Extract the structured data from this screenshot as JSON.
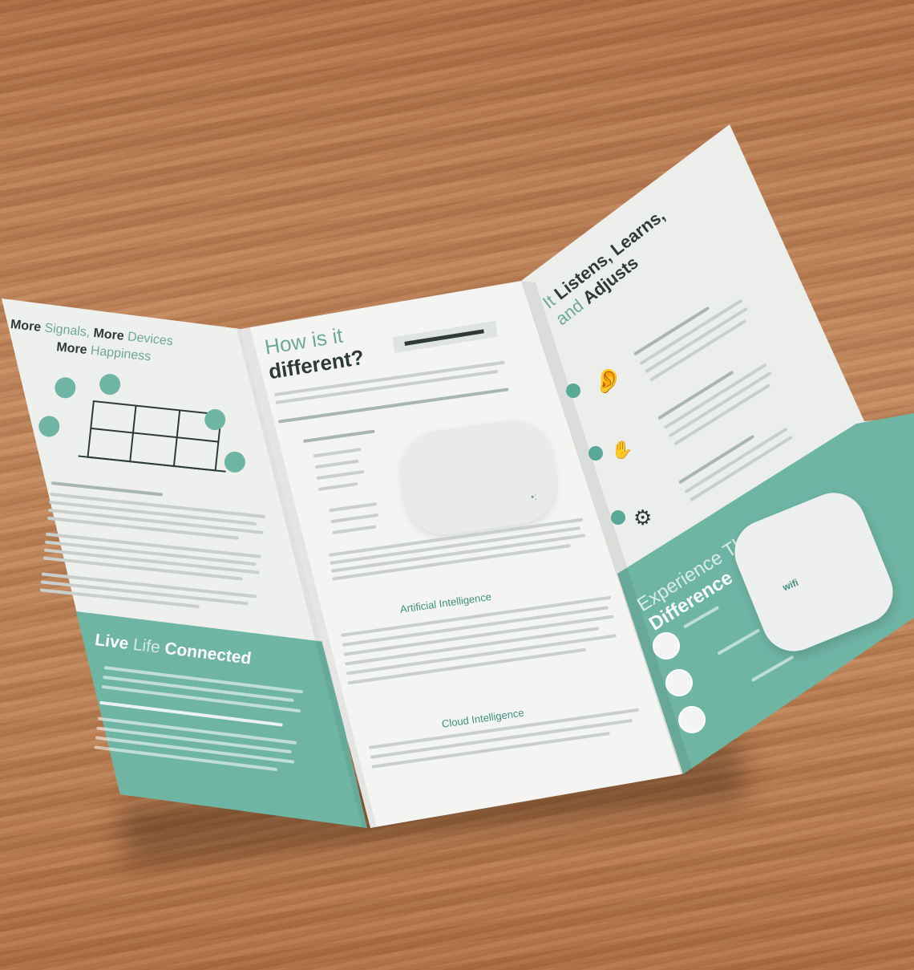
{
  "colors": {
    "accent": "#6fb5a4",
    "accent_dark": "#3f8f7e",
    "paper": "#f2f3f1",
    "wood": "#b87a4e",
    "text": "#2e3a37"
  },
  "left_panel": {
    "headline_1a": "More",
    "headline_1b": "Signals,",
    "headline_1c": "More",
    "headline_1d": "Devices",
    "headline_2a": "More",
    "headline_2b": "Happiness",
    "footer_title_a": "Live",
    "footer_title_b": "Life",
    "footer_title_c": "Connected"
  },
  "middle_panel": {
    "title_line1": "How is it",
    "title_line2": "different?",
    "subheading_a": "Artificial Intelligence",
    "subheading_b": "Cloud Intelligence"
  },
  "right_panel": {
    "title_line1a": "It",
    "title_line1b": "Listens, Learns,",
    "title_line2a": "and",
    "title_line2b": "Adjusts",
    "footer_title_a": "Experience The",
    "footer_title_b": "Difference",
    "device_label": "wifi",
    "icons": [
      "ear-icon",
      "hand-icon",
      "gear-icon"
    ]
  }
}
